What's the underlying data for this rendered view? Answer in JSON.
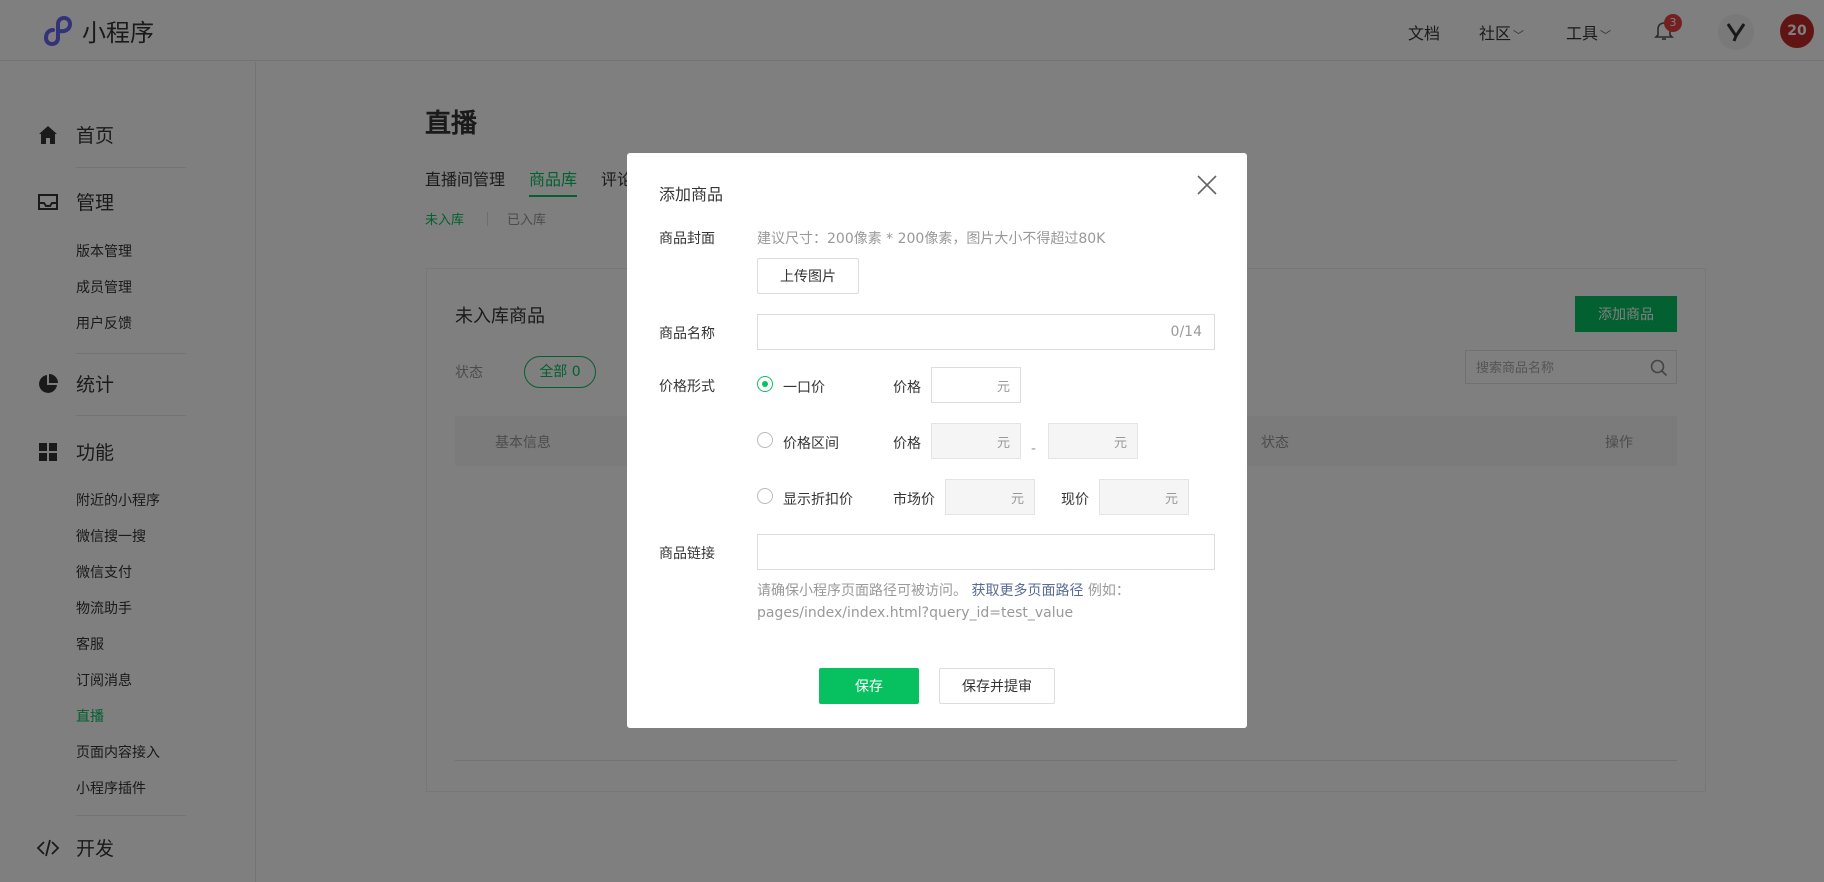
{
  "header": {
    "logo_text": "小程序",
    "nav": {
      "docs": "文档",
      "community": "社区",
      "tools": "工具"
    },
    "notification_count": "3",
    "avatar_text": "20"
  },
  "sidebar": {
    "groups": [
      {
        "label": "首页",
        "icon": "home-icon"
      },
      {
        "label": "管理",
        "icon": "inbox-icon",
        "items": [
          "版本管理",
          "成员管理",
          "用户反馈"
        ]
      },
      {
        "label": "统计",
        "icon": "pie-chart-icon"
      },
      {
        "label": "功能",
        "icon": "grid-icon",
        "items": [
          "附近的小程序",
          "微信搜一搜",
          "微信支付",
          "物流助手",
          "客服",
          "订阅消息",
          "直播",
          "页面内容接入",
          "小程序插件"
        ]
      },
      {
        "label": "开发",
        "icon": "code-icon"
      }
    ],
    "active_item": "直播"
  },
  "main": {
    "title": "直播",
    "tabs": [
      "直播间管理",
      "商品库",
      "评论"
    ],
    "active_tab": "商品库",
    "subtabs": [
      "未入库",
      "已入库"
    ],
    "card": {
      "title": "未入库商品",
      "add_button": "添加商品",
      "status_label": "状态",
      "status_filter": "全部 0",
      "search_placeholder": "搜索商品名称",
      "columns": [
        "基本信息",
        "状态",
        "操作"
      ]
    }
  },
  "modal": {
    "title": "添加商品",
    "cover": {
      "label": "商品封面",
      "hint": "建议尺寸：200像素 * 200像素，图片大小不得超过80K",
      "upload_button": "上传图片"
    },
    "name": {
      "label": "商品名称",
      "value": "",
      "counter": "0/14"
    },
    "price": {
      "label": "价格形式",
      "options": [
        {
          "label": "一口价",
          "checked": true
        },
        {
          "label": "价格区间",
          "checked": false
        },
        {
          "label": "显示折扣价",
          "checked": false
        }
      ],
      "price_label": "价格",
      "market_price_label": "市场价",
      "current_price_label": "现价",
      "unit": "元",
      "range_separator": "-"
    },
    "link": {
      "label": "商品链接",
      "value": "",
      "tip_prefix": "请确保小程序页面路径可被访问。",
      "tip_link": "获取更多页面路径",
      "tip_suffix": " 例如：pages/index/index.html?query_id=test_value"
    },
    "buttons": {
      "save": "保存",
      "save_and_review": "保存并提审"
    }
  },
  "colors": {
    "brand_green": "#07c160",
    "link_blue": "#576b95",
    "badge_red": "#e64340"
  }
}
